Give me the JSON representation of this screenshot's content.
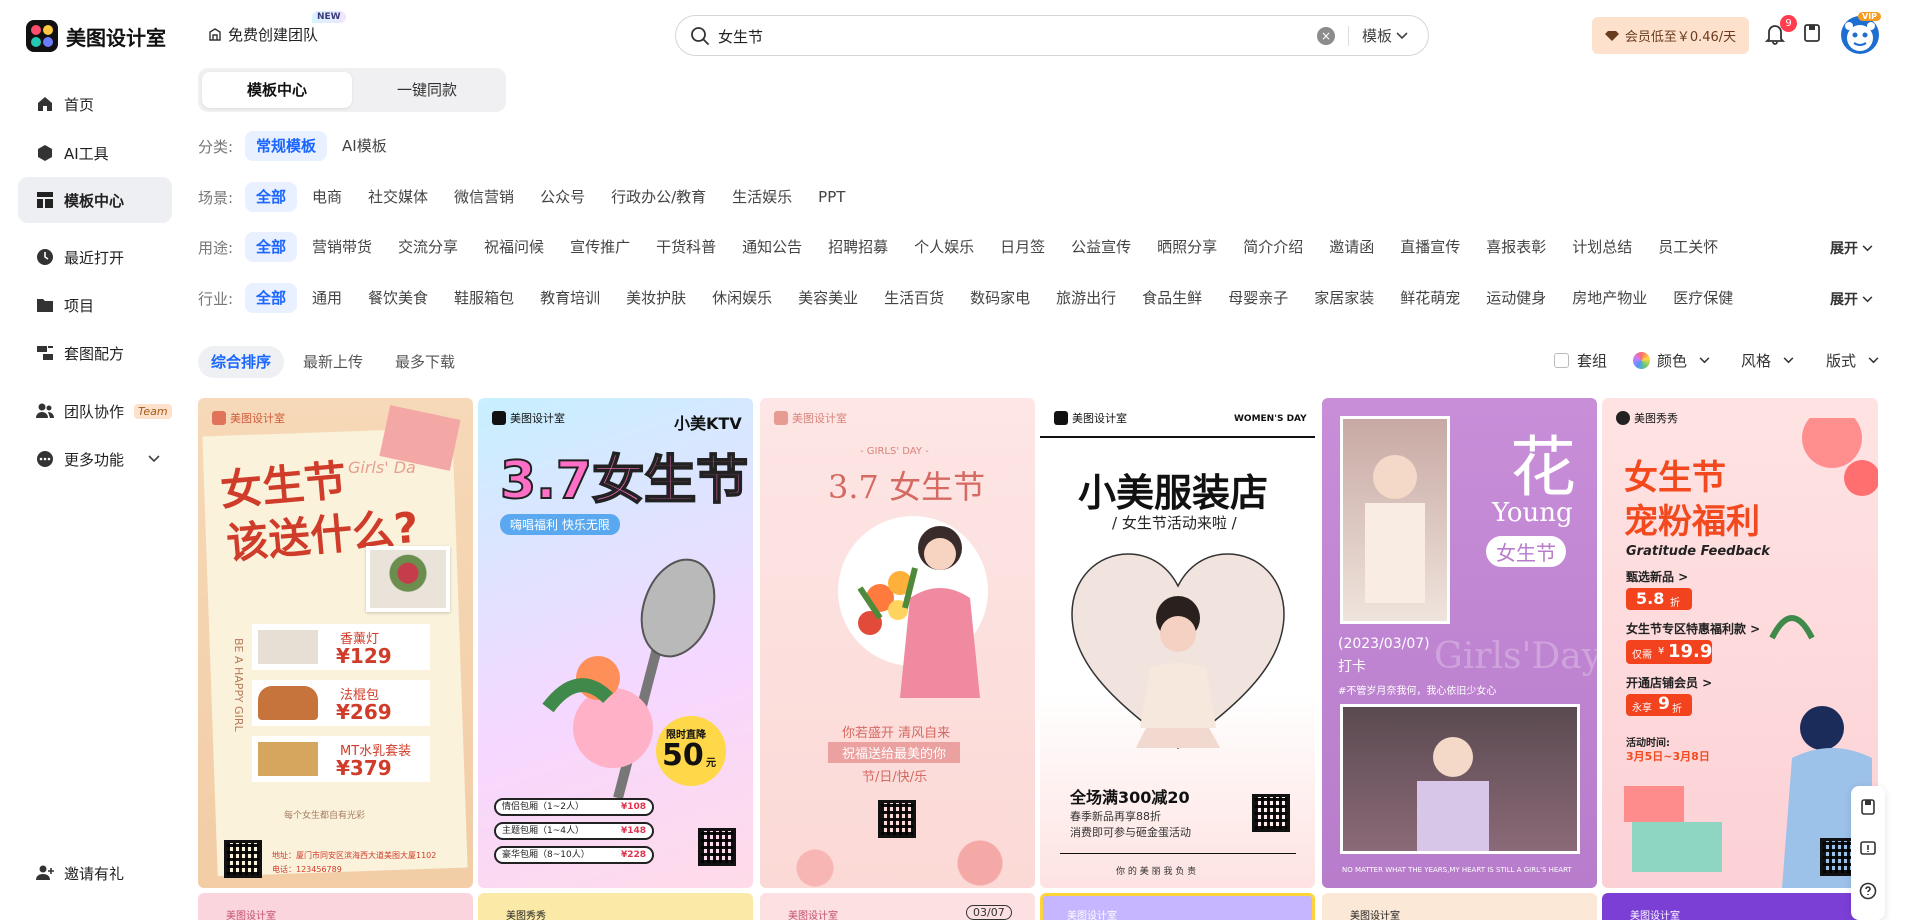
{
  "header": {
    "logo_text": "美图设计室",
    "team_button": "免费创建团队",
    "new_badge": "NEW",
    "search_value": "女生节",
    "search_type": "模板",
    "vip_promo": "会员低至￥0.46/天",
    "notification_count": "9",
    "vip_tag": "VIP"
  },
  "sidebar": {
    "items": [
      {
        "label": "首页",
        "icon": "home-icon"
      },
      {
        "label": "AI工具",
        "icon": "ai-tools-icon"
      },
      {
        "label": "模板中心",
        "icon": "template-icon",
        "active": true
      },
      {
        "label": "最近打开",
        "icon": "clock-icon"
      },
      {
        "label": "项目",
        "icon": "folder-icon"
      },
      {
        "label": "套图配方",
        "icon": "recipe-icon"
      },
      {
        "label": "团队协作",
        "icon": "team-icon",
        "tag": "Team"
      },
      {
        "label": "更多功能",
        "icon": "more-icon"
      },
      {
        "label": "邀请有礼",
        "icon": "invite-icon"
      }
    ]
  },
  "main_tabs": [
    "模板中心",
    "一键同款"
  ],
  "filters": {
    "category": {
      "label": "分类:",
      "options": [
        "常规模板",
        "AI模板"
      ]
    },
    "scene": {
      "label": "场景:",
      "options": [
        "全部",
        "电商",
        "社交媒体",
        "微信营销",
        "公众号",
        "行政办公/教育",
        "生活娱乐",
        "PPT"
      ]
    },
    "usage": {
      "label": "用途:",
      "options": [
        "全部",
        "营销带货",
        "交流分享",
        "祝福问候",
        "宣传推广",
        "干货科普",
        "通知公告",
        "招聘招募",
        "个人娱乐",
        "日月签",
        "公益宣传",
        "晒照分享",
        "简介介绍",
        "邀请函",
        "直播宣传",
        "喜报表彰",
        "计划总结",
        "员工关怀"
      ]
    },
    "industry": {
      "label": "行业:",
      "options": [
        "全部",
        "通用",
        "餐饮美食",
        "鞋服箱包",
        "教育培训",
        "美妆护肤",
        "休闲娱乐",
        "美容美业",
        "生活百货",
        "数码家电",
        "旅游出行",
        "食品生鲜",
        "母婴亲子",
        "家居家装",
        "鲜花萌宠",
        "运动健身",
        "房地产物业",
        "医疗保健"
      ]
    },
    "expand_label": "展开"
  },
  "sort": {
    "options": [
      "综合排序",
      "最新上传",
      "最多下载"
    ],
    "set_label": "套组",
    "color_label": "颜色",
    "style_label": "风格",
    "format_label": "版式"
  },
  "cards": {
    "c1": {
      "brand": "美图设计室",
      "title1": "女生节",
      "title2": "该送什么?",
      "script": "Girls' Da",
      "vert": "BE A HAPPY GIRL",
      "items": [
        {
          "name": "香薰灯",
          "price": "¥129"
        },
        {
          "name": "法棍包",
          "price": "¥269"
        },
        {
          "name": "MT水乳套装",
          "price": "¥379"
        }
      ],
      "note": "每个女生都自有光彩",
      "addr": "地址：厦门市同安区滨海西大道美图大厦1102",
      "tel": "电话：123456789"
    },
    "c2": {
      "brand": "美图设计室",
      "ktv": "小美KTV",
      "title": "3.7女生节",
      "sub": "嗨唱福利 快乐无限",
      "limit": "限时直降",
      "num": "50",
      "unit": "元",
      "rooms": [
        {
          "name": "情侣包厢（1~2人）",
          "price": "¥108"
        },
        {
          "name": "主题包厢（1~4人）",
          "price": "¥148"
        },
        {
          "name": "豪华包厢（8~10人）",
          "price": "¥228"
        }
      ]
    },
    "c3": {
      "brand": "美图设计室",
      "tag": "- GIRLS' DAY -",
      "title": "3.7 女生节",
      "l1": "你若盛开 清风自来",
      "l2": "祝福送给最美的你",
      "l3": "节/日/快/乐"
    },
    "c4": {
      "brand": "美图设计室",
      "en": "WOMEN'S DAY",
      "title": "小美服装店",
      "sub": "/ 女生节活动来啦 /",
      "deal": "全场满300减20",
      "d1": "春季新品再享88折",
      "d2": "消费即可参与砸金蛋活动",
      "foot": "你 的 美 丽   我 负 责"
    },
    "c5": {
      "big": "花",
      "young": "Young",
      "pill": "女生节",
      "date": "(2023/03/07)",
      "check": "打卡",
      "ghost": "Girls'Day",
      "line": "#不管岁月奈我何，我心依旧少女心",
      "foot": "NO MATTER WHAT THE YEARS,MY HEART IS STILL A GIRL'S HEART"
    },
    "c6": {
      "brand": "美图秀秀",
      "t1": "女生节",
      "t2": "宠粉福利",
      "en": "Gratitude Feedback",
      "new": "甄选新品 >",
      "p1": "5.8",
      "fold": "折",
      "zone": "女生节专区特惠福利款 >",
      "only": "仅需",
      "p2": "19.9",
      "yen": "¥",
      "member": "开通店铺会员 >",
      "enjoy": "永享",
      "p3": "9",
      "time_label": "活动时间:",
      "time": "3月5日~3月8日"
    }
  },
  "row2": {
    "b1": "美图设计室",
    "b2": "美图秀秀",
    "b3": "美图设计室",
    "b3date": "03/07",
    "b4": "美图设计室",
    "b5": "美图设计室",
    "b6": "美图设计室"
  },
  "colors": {
    "accent": "#1a66ff",
    "vip_bg": "#fde1cd",
    "badge_red": "#ff3d4f"
  }
}
